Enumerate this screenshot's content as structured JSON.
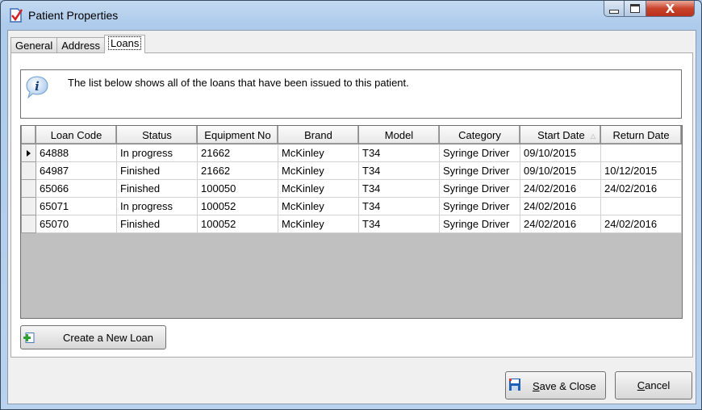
{
  "window": {
    "title": "Patient Properties",
    "icon": "checklist-icon",
    "controls": {
      "minimize": "minimize",
      "maximize": "maximize",
      "close": "X"
    }
  },
  "tabs": [
    {
      "label": "General",
      "active": false
    },
    {
      "label": "Address",
      "active": false
    },
    {
      "label": "Loans",
      "active": true
    }
  ],
  "info": {
    "icon": "info-icon",
    "text": "The list below shows all of the loans that have been issued to this patient."
  },
  "grid": {
    "columns": [
      "Loan Code",
      "Status",
      "Equipment No",
      "Brand",
      "Model",
      "Category",
      "Start Date",
      "Return Date"
    ],
    "sorted_column": "Start Date",
    "sort_direction": "ascending",
    "current_row": 0,
    "rows": [
      [
        "64888",
        "In progress",
        "21662",
        "McKinley",
        "T34",
        "Syringe Driver",
        "09/10/2015",
        ""
      ],
      [
        "64987",
        "Finished",
        "21662",
        "McKinley",
        "T34",
        "Syringe Driver",
        "09/10/2015",
        "10/12/2015"
      ],
      [
        "65066",
        "Finished",
        "100050",
        "McKinley",
        "T34",
        "Syringe Driver",
        "24/02/2016",
        "24/02/2016"
      ],
      [
        "65071",
        "In progress",
        "100052",
        "McKinley",
        "T34",
        "Syringe Driver",
        "24/02/2016",
        ""
      ],
      [
        "65070",
        "Finished",
        "100052",
        "McKinley",
        "T34",
        "Syringe Driver",
        "24/02/2016",
        "24/02/2016"
      ]
    ]
  },
  "buttons": {
    "create_new_loan": "Create a New Loan",
    "save_close_prefix": "S",
    "save_close_rest": "ave & Close",
    "cancel_prefix": "C",
    "cancel_rest": "ancel"
  },
  "colors": {
    "close_button": "#c9432a",
    "grid_empty_area": "#c0c0c0",
    "title_bar": "#b9d2ee"
  }
}
